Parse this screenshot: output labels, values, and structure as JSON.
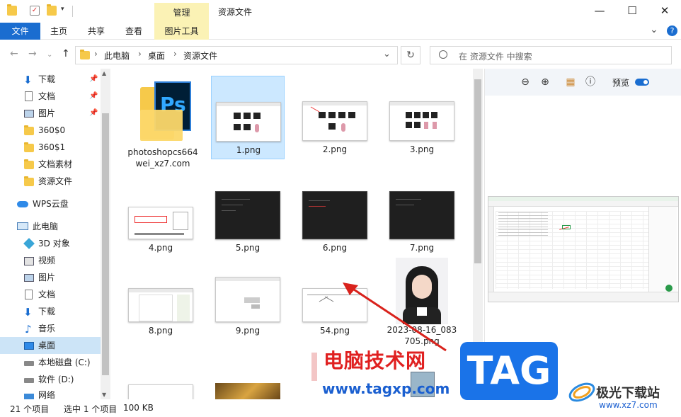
{
  "titlebar": {
    "manage_tab": "管理",
    "title": "资源文件",
    "minimize": "—",
    "maximize": "☐",
    "close": "✕"
  },
  "ribbon": {
    "tabs": [
      "文件",
      "主页",
      "共享",
      "查看",
      "图片工具"
    ],
    "chevron": "⌄",
    "help": "?"
  },
  "address": {
    "breadcrumb": [
      "此电脑",
      "桌面",
      "资源文件"
    ],
    "separator": "›",
    "dropdown": "⌄",
    "refresh": "↻",
    "search_placeholder": "在 资源文件 中搜索"
  },
  "sidebar": {
    "items": [
      {
        "label": "下载",
        "icon": "download-icon",
        "pinned": true
      },
      {
        "label": "文档",
        "icon": "document-icon",
        "pinned": true
      },
      {
        "label": "图片",
        "icon": "picture-icon",
        "pinned": true
      },
      {
        "label": "360$0",
        "icon": "folder-icon"
      },
      {
        "label": "360$1",
        "icon": "folder-icon"
      },
      {
        "label": "文档素材",
        "icon": "folder-icon"
      },
      {
        "label": "资源文件",
        "icon": "folder-icon"
      },
      {
        "label": "WPS云盘",
        "icon": "cloud-icon"
      },
      {
        "label": "此电脑",
        "icon": "computer-icon"
      },
      {
        "label": "3D 对象",
        "icon": "cube-icon"
      },
      {
        "label": "视频",
        "icon": "video-icon"
      },
      {
        "label": "图片",
        "icon": "picture-icon"
      },
      {
        "label": "文档",
        "icon": "document-icon"
      },
      {
        "label": "下载",
        "icon": "download-icon"
      },
      {
        "label": "音乐",
        "icon": "music-icon"
      },
      {
        "label": "桌面",
        "icon": "desktop-icon",
        "selected": true
      },
      {
        "label": "本地磁盘 (C:)",
        "icon": "drive-icon"
      },
      {
        "label": "软件 (D:)",
        "icon": "drive-icon"
      },
      {
        "label": "网络",
        "icon": "network-icon"
      }
    ]
  },
  "files": [
    {
      "name": "photoshopcs664wei_xz7.com",
      "kind": "folder-ps"
    },
    {
      "name": "1.png",
      "kind": "screenshot",
      "selected": true
    },
    {
      "name": "2.png",
      "kind": "screenshot"
    },
    {
      "name": "3.png",
      "kind": "screenshot"
    },
    {
      "name": "4.png",
      "kind": "dialog"
    },
    {
      "name": "5.png",
      "kind": "dark"
    },
    {
      "name": "6.png",
      "kind": "dark"
    },
    {
      "name": "7.png",
      "kind": "dark"
    },
    {
      "name": "8.png",
      "kind": "doc"
    },
    {
      "name": "9.png",
      "kind": "doc"
    },
    {
      "name": "54.png",
      "kind": "doc"
    },
    {
      "name": "2023-08-16_083705.png",
      "kind": "portrait"
    }
  ],
  "preview": {
    "toggle_label": "预览"
  },
  "status": {
    "count": "21 个项目",
    "selected": "选中 1 个项目",
    "size": "100 KB"
  },
  "watermark": {
    "cn": "电脑技术网",
    "url": "www.tagxp.com",
    "tag": "TAG",
    "logo_text": "极光下载站",
    "logo_url": "www.xz7.com"
  }
}
